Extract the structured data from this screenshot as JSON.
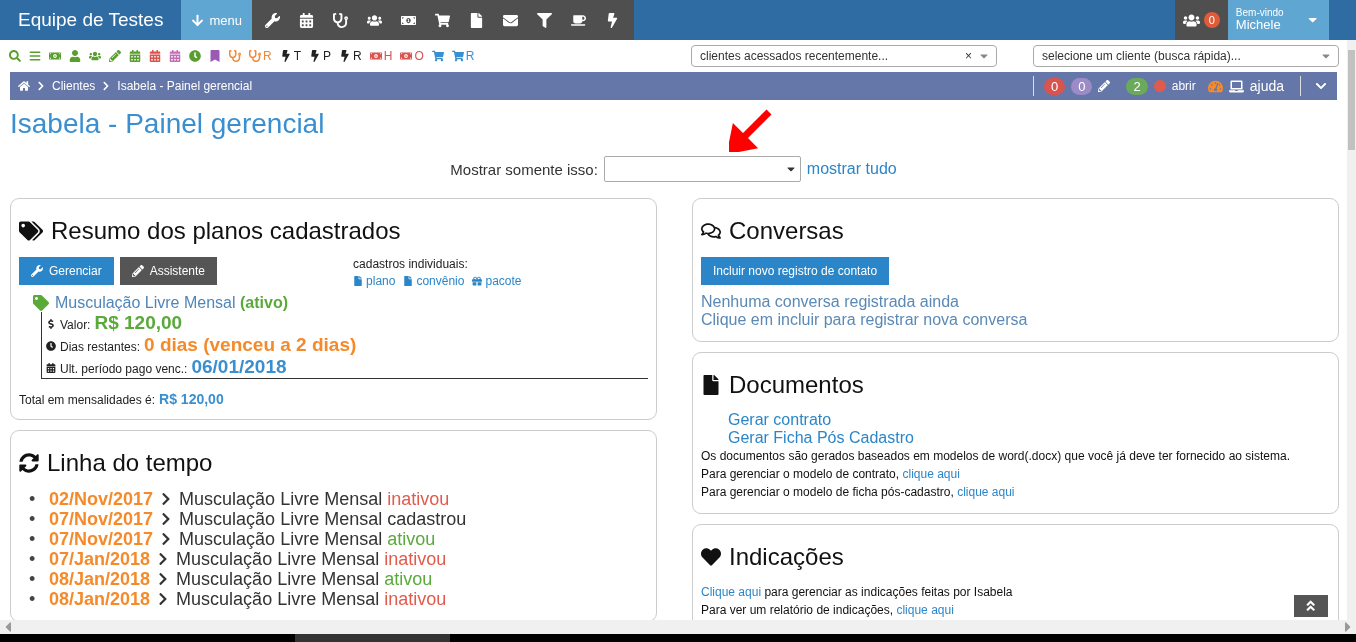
{
  "header": {
    "brand": "Equipe de Testes",
    "menu": "menu",
    "notifications": "0",
    "welcome": "Bem-vindo",
    "user": "Michele"
  },
  "toolbar": [
    {
      "color": "#5a9e2f"
    },
    {
      "color": "#5a9e2f"
    },
    {
      "color": "#5a9e2f"
    },
    {
      "color": "#5a9e2f"
    },
    {
      "color": "#5a9e2f"
    },
    {
      "color": "#5a9e2f"
    },
    {
      "color": "#5a9e2f"
    },
    {
      "color": "#d9534f"
    },
    {
      "color": "#c46fb5"
    },
    {
      "color": "#5a9e2f"
    },
    {
      "color": "#9b59b6"
    },
    {
      "color": "#f0883a"
    },
    {
      "color": "#f0883a",
      "label": "R"
    },
    {
      "color": "#222222",
      "label": "T"
    },
    {
      "color": "#222222",
      "label": "P"
    },
    {
      "color": "#222222",
      "label": "R"
    },
    {
      "color": "#d9534f",
      "label": "H"
    },
    {
      "color": "#d9534f",
      "label": "O"
    },
    {
      "color": "#3a8fd0"
    },
    {
      "color": "#3a8fd0",
      "label": "R"
    }
  ],
  "selects": [
    {
      "placeholder": "clientes acessados recentemente...",
      "clear": "×"
    },
    {
      "placeholder": "selecione um cliente (busca rápida)..."
    }
  ],
  "breadcrumb": {
    "items": [
      "Clientes",
      "Isabela - Painel gerencial"
    ],
    "actions": [
      {
        "kind": "badge",
        "text": "0",
        "color": "#d9534f"
      },
      {
        "kind": "badge",
        "text": "0",
        "color": "#9b8bc6"
      },
      {
        "kind": "pencil"
      },
      {
        "kind": "badge",
        "text": "2",
        "color": "#6aaa5a"
      },
      {
        "kind": "dot",
        "color": "#e05b4b"
      },
      {
        "kind": "link",
        "text": "abrir"
      },
      {
        "kind": "gauge"
      },
      {
        "kind": "laptop"
      },
      {
        "kind": "link",
        "text": "ajuda"
      }
    ]
  },
  "page_title": "Isabela - Painel gerencial",
  "filter": {
    "label": "Mostrar somente isso:",
    "link": "mostrar tudo"
  },
  "plans": {
    "title": "Resumo dos planos cadastrados",
    "buttons": [
      {
        "kind": "primary",
        "text": "Gerenciar"
      },
      {
        "kind": "dark",
        "text": "Assistente"
      }
    ],
    "individual_label": "cadastros individuais:",
    "individual_links": [
      {
        "kind": "file",
        "text": "plano"
      },
      {
        "kind": "file",
        "text": "convênio"
      },
      {
        "kind": "gift",
        "text": "pacote"
      }
    ],
    "plan": {
      "name": "Musculação Livre Mensal",
      "status": "(ativo)",
      "rows": [
        {
          "kind": "dollar",
          "label": "Valor:",
          "value": "R$ 120,00",
          "color": "#5aaa3a"
        },
        {
          "kind": "clock",
          "label": "Dias restantes:",
          "value": "0 dias (venceu a 2 dias)",
          "color": "#f58a2a"
        },
        {
          "kind": "calendar",
          "label": "Ult. período pago venc.:",
          "value": "06/01/2018",
          "color": "#3a8fd0"
        }
      ]
    },
    "total_label": "Total em mensalidades é:",
    "total_value": "R$ 120,00"
  },
  "timeline": {
    "title": "Linha do tempo",
    "items": [
      {
        "marker": "•",
        "date": "02/Nov/2017",
        "plan": "Musculação Livre Mensal",
        "action": "inativou",
        "kind": "inactive"
      },
      {
        "marker": "•",
        "date": "07/Nov/2017",
        "plan": "Musculação Livre Mensal",
        "action": "cadastrou",
        "kind": "registered"
      },
      {
        "marker": "•",
        "date": "07/Nov/2017",
        "plan": "Musculação Livre Mensal",
        "action": "ativou",
        "kind": "active"
      },
      {
        "marker": "•",
        "date": "07/Jan/2018",
        "plan": "Musculação Livre Mensal",
        "action": "inativou",
        "kind": "inactive"
      },
      {
        "marker": "•",
        "date": "08/Jan/2018",
        "plan": "Musculação Livre Mensal",
        "action": "ativou",
        "kind": "active"
      },
      {
        "marker": "•",
        "date": "08/Jan/2018",
        "plan": "Musculação Livre Mensal",
        "action": "inativou",
        "kind": "inactive"
      }
    ]
  },
  "conversations": {
    "title": "Conversas",
    "button": "Incluir novo registro de contato",
    "messages": [
      "Nenhuma conversa registrada ainda",
      "Clique em incluir para registrar nova conversa"
    ]
  },
  "documents": {
    "title": "Documentos",
    "links": [
      "Gerar contrato",
      "Gerar Ficha Pós Cadastro"
    ],
    "note": "Os documentos são gerados baseados em modelos de word(.docx) que você já deve ter fornecido ao sistema.",
    "lines": [
      {
        "parts": [
          {
            "kind": "text",
            "text": "Para gerenciar o modelo de contrato,"
          },
          {
            "kind": "link",
            "text": "clique aqui"
          }
        ]
      },
      {
        "parts": [
          {
            "kind": "text",
            "text": "Para gerenciar o modelo de ficha pós-cadastro,"
          },
          {
            "kind": "link",
            "text": "clique aqui"
          }
        ]
      }
    ]
  },
  "referrals": {
    "title": "Indicações",
    "lines": [
      {
        "parts": [
          {
            "kind": "link",
            "text": "Clique aqui"
          },
          {
            "kind": "text",
            "text": "para gerenciar as indicações feitas por Isabela"
          }
        ]
      },
      {
        "parts": [
          {
            "kind": "text",
            "text": "Para ver um relatório de indicações,"
          },
          {
            "kind": "link",
            "text": "clique aqui"
          }
        ]
      }
    ]
  }
}
